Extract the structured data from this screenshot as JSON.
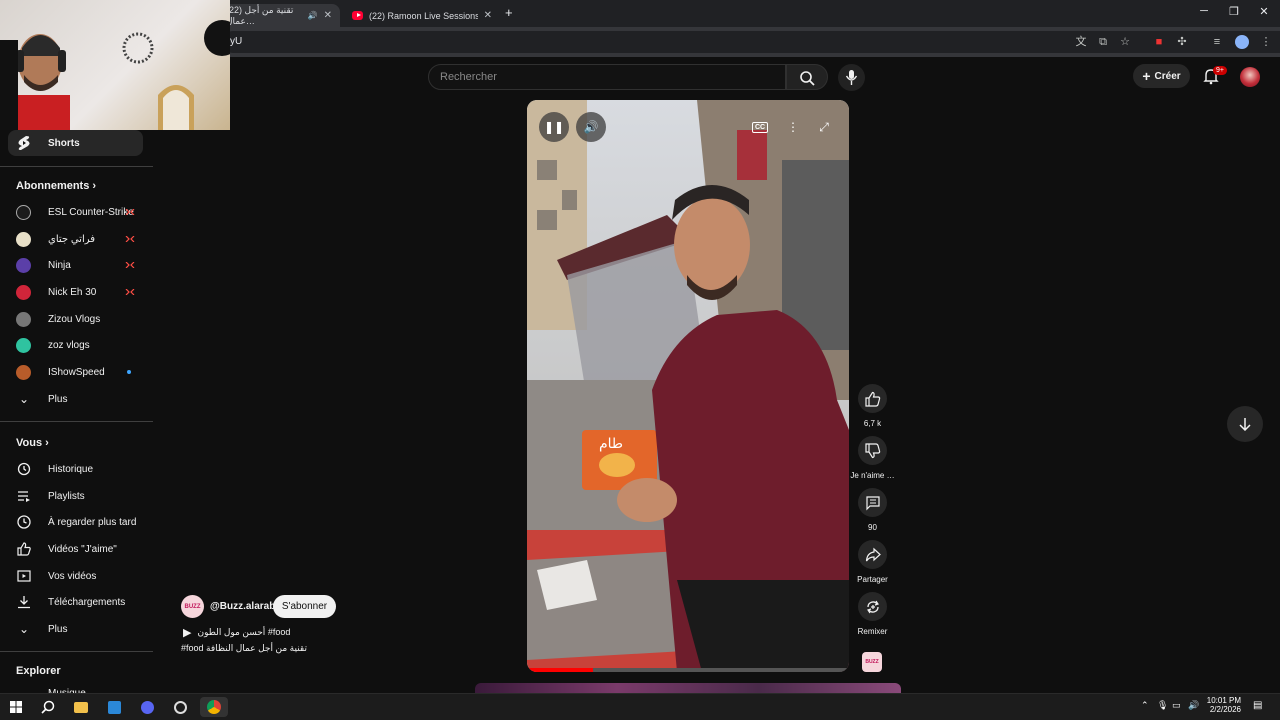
{
  "browser": {
    "tabs": [
      {
        "title": "(22) تقنية من أجل عمال…",
        "active": true
      },
      {
        "title": "(22) Ramoon Live Sessions — E…",
        "active": false
      }
    ],
    "new_tab": "+",
    "url_fragment": "yU",
    "window_controls": {
      "minimize": "─",
      "restore": "❐",
      "close": "✕"
    }
  },
  "youtube": {
    "search_placeholder": "Rechercher",
    "create_label": "Créer",
    "notifications_badge": "9+",
    "sidebar": {
      "shorts": "Shorts",
      "subscriptions_title": "Abonnements",
      "subscriptions": [
        {
          "name": "ESL Counter-Strike",
          "status": "live",
          "color": "#1b1b1b"
        },
        {
          "name": "فراتي جتاي",
          "status": "live",
          "color": "#e8e0c8"
        },
        {
          "name": "Ninja",
          "status": "live",
          "color": "#5b3fa8"
        },
        {
          "name": "Nick Eh 30",
          "status": "live",
          "color": "#d0253a"
        },
        {
          "name": "Zizou Vlogs",
          "status": "",
          "color": "#777777"
        },
        {
          "name": "zoz vlogs",
          "status": "",
          "color": "#2fc3a0"
        },
        {
          "name": "IShowSpeed",
          "status": "new",
          "color": "#b85c2a"
        }
      ],
      "subs_more": "Plus",
      "you_title": "Vous",
      "you_items": [
        {
          "label": "Historique",
          "icon": "history-icon"
        },
        {
          "label": "Playlists",
          "icon": "playlist-icon"
        },
        {
          "label": "À regarder plus tard",
          "icon": "clock-icon"
        },
        {
          "label": "Vidéos \"J'aime\"",
          "icon": "thumb-up-icon"
        },
        {
          "label": "Vos vidéos",
          "icon": "video-icon"
        },
        {
          "label": "Téléchargements",
          "icon": "download-icon"
        }
      ],
      "you_more": "Plus",
      "explore_title": "Explorer",
      "explore_first": "Musique"
    },
    "short": {
      "channel_handle": "@Buzz.alarab",
      "channel_logo_text": "BUZZ",
      "subscribe_label": "S'abonner",
      "line1": "أحسن مول الطون #food",
      "line2": "#food تقنية من أجل عمال النظافة",
      "actions": {
        "likes": "6,7 k",
        "dislike": "Je n'aime …",
        "comments": "90",
        "share": "Partager",
        "remix": "Remixer"
      },
      "can_text": "طام"
    }
  },
  "taskbar": {
    "time": "10:01 PM",
    "date": "2/2/2026"
  }
}
